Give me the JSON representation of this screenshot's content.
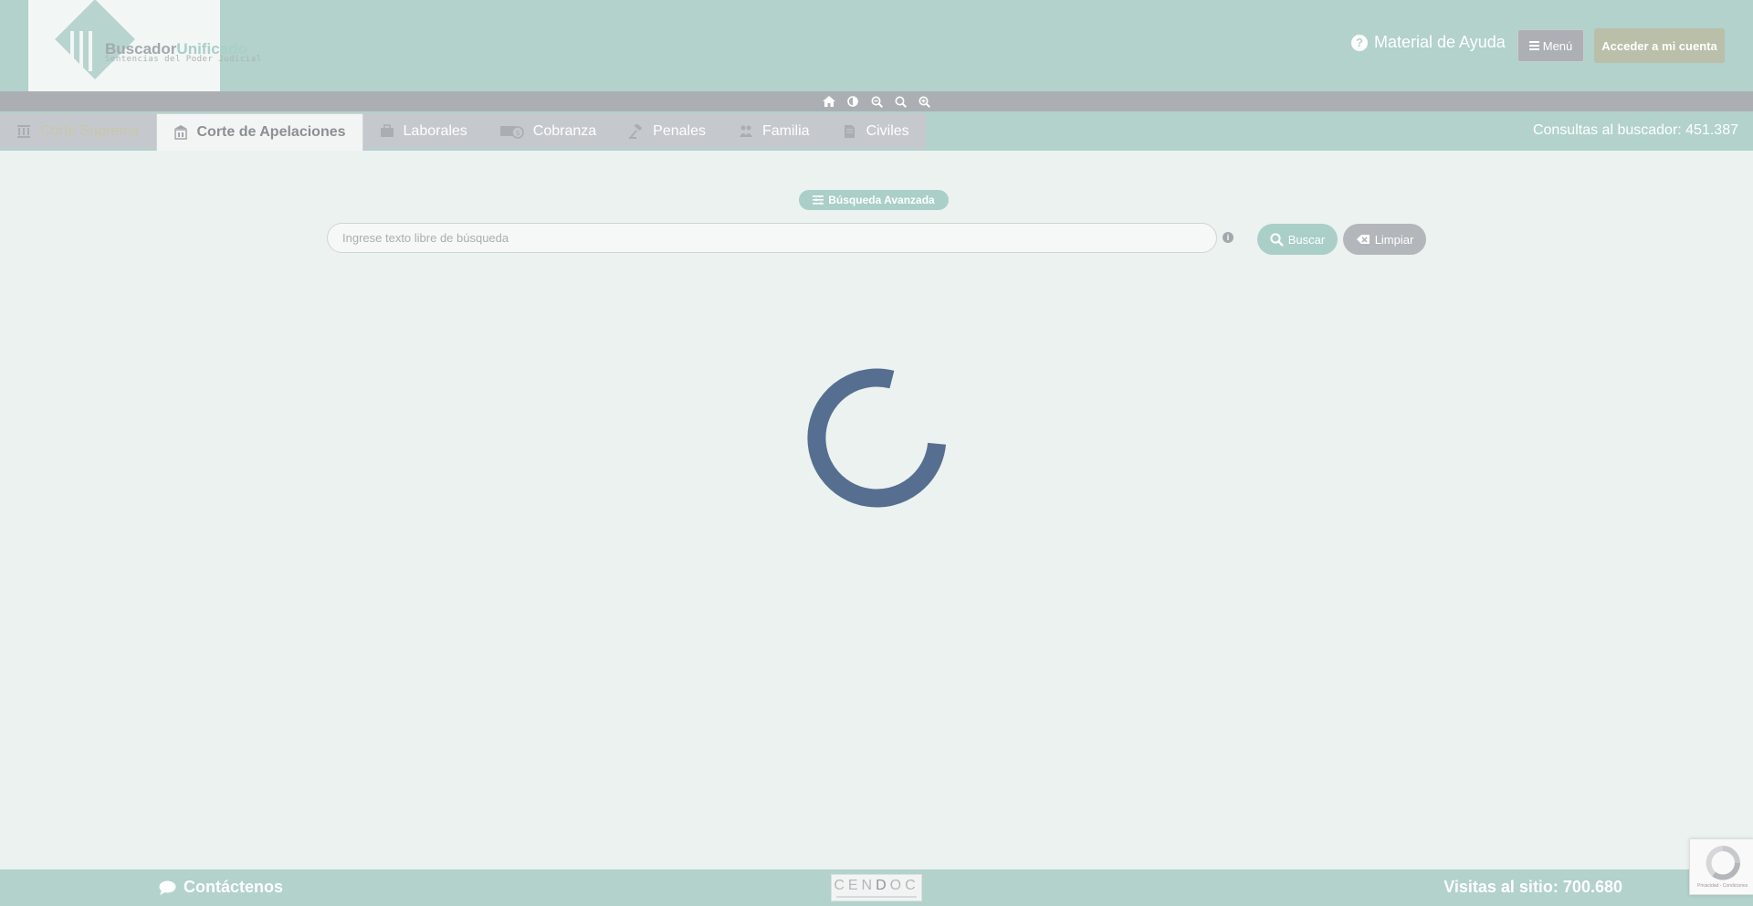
{
  "header": {
    "logo": {
      "title_part1": "Buscador",
      "title_part2": "Unificado",
      "subtitle": "Sentencias del Poder Judicial"
    },
    "help_label": "Material de Ayuda",
    "menu_label": "Menú",
    "account_label": "Acceder a mi cuenta"
  },
  "accessibility_toolbar": {
    "icons": [
      "home-icon",
      "contrast-icon",
      "zoom-out-icon",
      "zoom-reset-icon",
      "zoom-in-icon"
    ]
  },
  "tabs": [
    {
      "label": "Corte Suprema",
      "icon": "columns-icon",
      "state": "disabled"
    },
    {
      "label": "Corte de Apelaciones",
      "icon": "courthouse-icon",
      "state": "active"
    },
    {
      "label": "Laborales",
      "icon": "briefcase-icon",
      "state": "normal"
    },
    {
      "label": "Cobranza",
      "icon": "money-icon",
      "state": "normal"
    },
    {
      "label": "Penales",
      "icon": "gavel-icon",
      "state": "normal"
    },
    {
      "label": "Familia",
      "icon": "family-icon",
      "state": "normal"
    },
    {
      "label": "Civiles",
      "icon": "document-icon",
      "state": "normal"
    }
  ],
  "query_counter": "Consultas al buscador: 451.387",
  "search": {
    "advanced_label": "Búsqueda Avanzada",
    "placeholder": "Ingrese texto libre de búsqueda",
    "value": "",
    "search_label": "Buscar",
    "clear_label": "Limpiar"
  },
  "loading": true,
  "footer": {
    "contact_label": "Contáctenos",
    "cendoc_logo": "CENDOC",
    "visits": "Visitas al sitio: 700.680"
  },
  "recaptcha": {
    "caption": "Privacidad - Condiciones"
  },
  "colors": {
    "primary_teal": "#b2d2cb",
    "background": "#ecf2ef",
    "toolbar_gray": "#abafb3",
    "tab_gray": "#c5c8cd",
    "spinner_blue": "#566f91",
    "account_button": "#b9bfa9"
  }
}
